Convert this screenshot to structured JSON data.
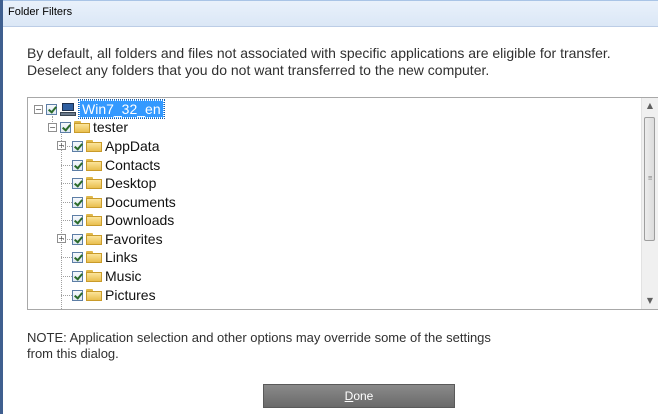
{
  "window": {
    "title": "Folder Filters"
  },
  "intro": {
    "line1": "By default, all folders and files not associated with specific applications are eligible for transfer.",
    "line2": "Deselect any folders that you do not want transferred to the new computer."
  },
  "tree": {
    "root": {
      "label": "Win7_32_en",
      "checked": true,
      "expanded": true,
      "icon": "computer-icon"
    },
    "user": {
      "label": "tester",
      "checked": true,
      "expanded": true,
      "icon": "folder-icon"
    },
    "items": [
      {
        "label": "AppData",
        "checked": true,
        "expander": "+"
      },
      {
        "label": "Contacts",
        "checked": true,
        "expander": ""
      },
      {
        "label": "Desktop",
        "checked": true,
        "expander": ""
      },
      {
        "label": "Documents",
        "checked": true,
        "expander": ""
      },
      {
        "label": "Downloads",
        "checked": true,
        "expander": ""
      },
      {
        "label": "Favorites",
        "checked": true,
        "expander": "+"
      },
      {
        "label": "Links",
        "checked": true,
        "expander": ""
      },
      {
        "label": "Music",
        "checked": true,
        "expander": ""
      },
      {
        "label": "Pictures",
        "checked": true,
        "expander": ""
      }
    ]
  },
  "note": {
    "line1": "NOTE:  Application selection and other options may override some of the settings",
    "line2": "from this dialog."
  },
  "buttons": {
    "done_first": "D",
    "done_rest": "one"
  },
  "colors": {
    "selection": "#3399ff",
    "button": "#7a7a7a"
  }
}
